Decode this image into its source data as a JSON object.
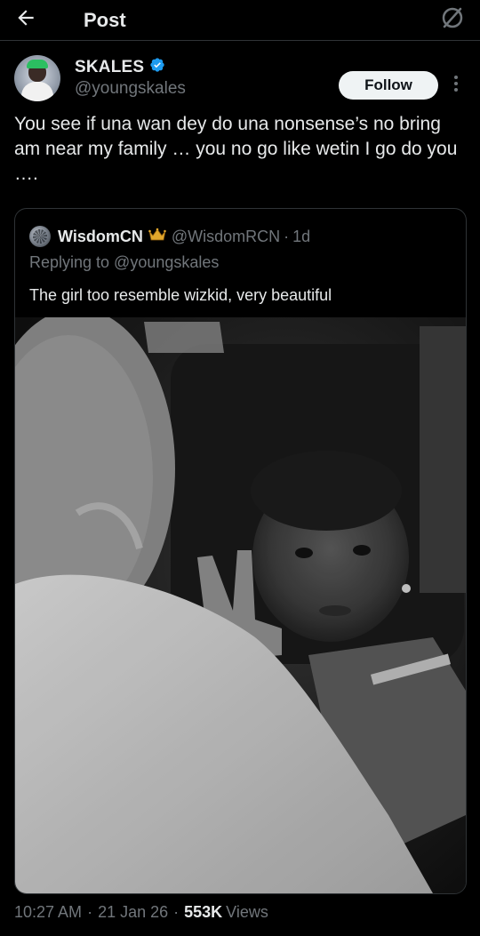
{
  "header": {
    "title": "Post",
    "back_icon": "back-arrow-icon",
    "right_icon": "grok-icon"
  },
  "author": {
    "display_name": "SKALES",
    "handle": "@youngskales",
    "verified": true,
    "verified_color": "#1d9bf0"
  },
  "actions": {
    "follow_label": "Follow",
    "more_icon": "more-vertical-icon"
  },
  "tweet": {
    "text": "You see if una wan dey do una nonsense’s no bring am near my family … you no go like wetin I go do you …."
  },
  "quote": {
    "display_name": "WisdomCN",
    "badge_icon": "crown-icon",
    "handle": "@WisdomRCN",
    "separator": "·",
    "time": "1d",
    "replying_to": "Replying to @youngskales",
    "text": "The girl too resemble wizkid, very beautiful",
    "media_desc_icon": "photo-icon"
  },
  "meta": {
    "time": "10:27 AM",
    "separator1": "·",
    "date": "21 Jan 26",
    "separator2": "·",
    "views_count": "553K",
    "views_label": "Views"
  },
  "colors": {
    "background": "#000000",
    "primary_text": "#e7e9ea",
    "secondary_text": "#71767b",
    "border": "#2f3336",
    "follow_bg": "#eff3f4"
  }
}
